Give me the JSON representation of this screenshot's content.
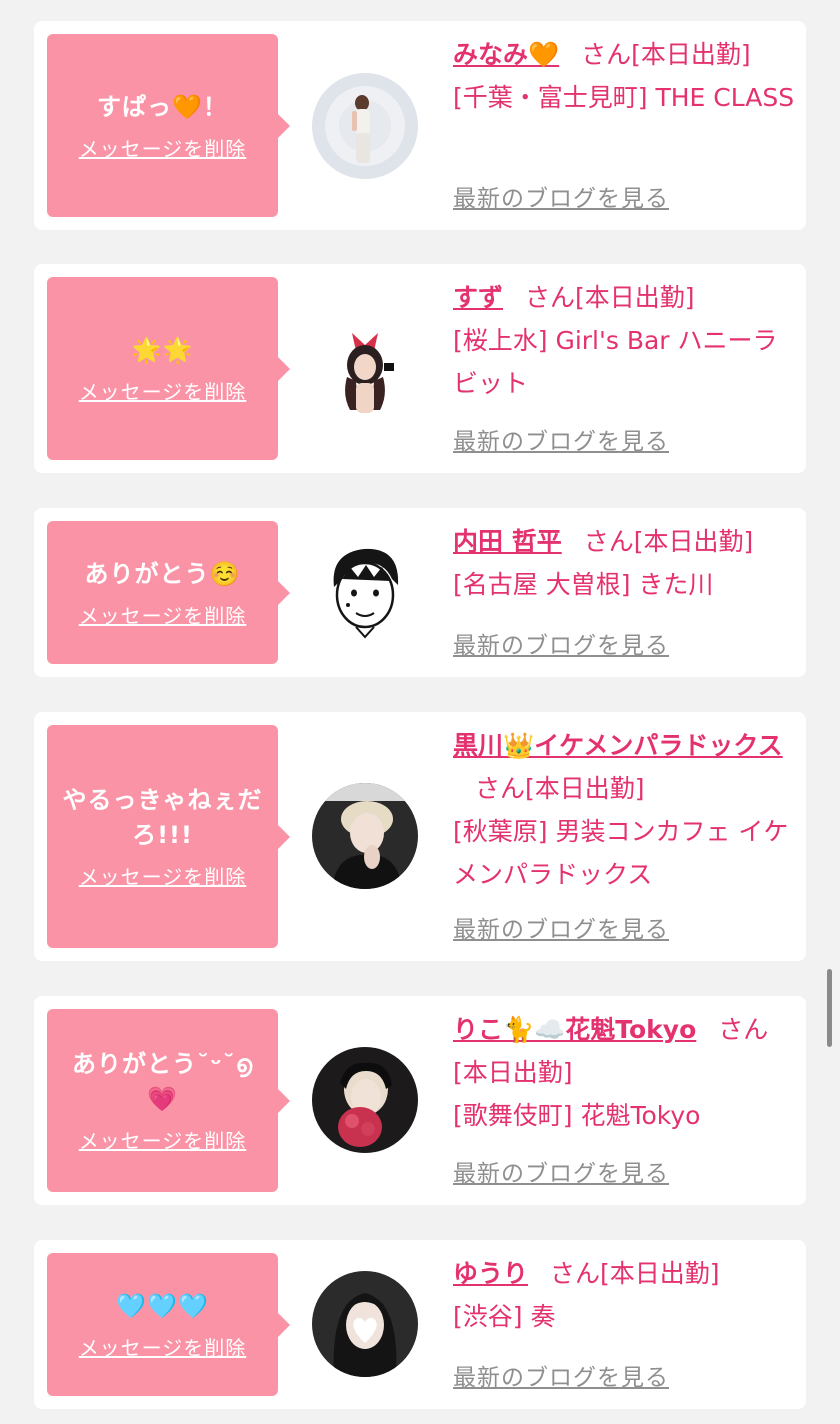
{
  "colors": {
    "background": "#f2f2f2",
    "bubble": "#fb93a6",
    "accent": "#e4316f",
    "link_gray": "#8f8f8f"
  },
  "common": {
    "delete_label": "メッセージを削除",
    "blog_label": "最新のブログを見る",
    "honorific": "さん[本日出勤]"
  },
  "messages": [
    {
      "message": "すぱっ🧡！",
      "name": "みなみ🧡",
      "location": "[千葉・富士見町] THE CLASS",
      "avatar": "photo-woman-white-outfit"
    },
    {
      "message": "🌟🌟",
      "name": "すず",
      "location": "[桜上水] Girl's Bar ハニーラビット",
      "avatar": "photo-woman-red-bow"
    },
    {
      "message": "ありがとう☺️",
      "name": "内田 哲平",
      "location": "[名古屋 大曽根] きた川",
      "avatar": "illustration-man-face"
    },
    {
      "message": "やるっきゃねぇだろ!!!",
      "name": "黒川👑イケメンパラドックス",
      "location": "[秋葉原] 男装コンカフェ イケメンパラドックス",
      "avatar": "photo-blonde-person"
    },
    {
      "message": "ありがとう˘ᵕ˘൭ 💗",
      "name": "りこ🐈☁️花魁Tokyo",
      "location": "[歌舞伎町] 花魁Tokyo",
      "avatar": "photo-woman-flowers"
    },
    {
      "message": "🩵🩵🩵",
      "name": "ゆうり",
      "location": "[渋谷] 奏",
      "avatar": "photo-woman-heart-mask"
    }
  ]
}
